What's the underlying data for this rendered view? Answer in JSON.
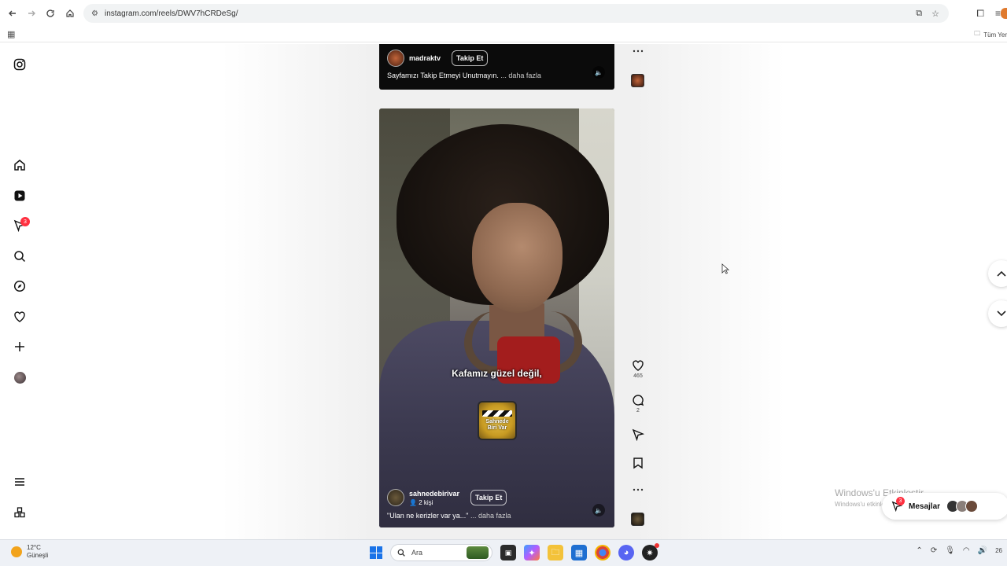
{
  "browser": {
    "url": "instagram.com/reels/DWV7hCRDeSg/",
    "bookmarks_right_label": "Tüm Yer"
  },
  "sidebar": {
    "notifications_badge": "3",
    "items": [
      {
        "icon": "instagram-logo-icon"
      },
      {
        "icon": "home-icon"
      },
      {
        "icon": "reels-icon"
      },
      {
        "icon": "messages-icon"
      },
      {
        "icon": "search-icon"
      },
      {
        "icon": "explore-icon"
      },
      {
        "icon": "heart-icon"
      },
      {
        "icon": "create-icon"
      },
      {
        "icon": "profile-avatar"
      },
      {
        "icon": "menu-icon"
      },
      {
        "icon": "more-apps-icon"
      }
    ]
  },
  "reel_prev": {
    "account": "madraktv",
    "follow_label": "Takip Et",
    "caption": "Sayfamızı Takip Etmeyi Unutmayın.",
    "more_label": "... daha fazla"
  },
  "reel_current": {
    "subtitle": "Kafamız güzel değil,",
    "stamp_line1": "Sahnede",
    "stamp_line2": "Biri Var",
    "account": "sahnedebirivar",
    "audience": "2 kişi",
    "follow_label": "Takip Et",
    "caption": "\"Ulan ne kerizler var ya...\"",
    "more_label": "... daha fazla",
    "likes": "465",
    "comments": "2"
  },
  "watermark": {
    "title": "Windows'u Etkinleştir",
    "subtitle": "Windows'u etkinleştirmek için Ayarlar'a gidin"
  },
  "messages": {
    "label": "Mesajlar",
    "badge": "3"
  },
  "taskbar": {
    "temperature": "12°C",
    "weather": "Güneşli",
    "search_placeholder": "Ara",
    "clock_partial": "26"
  }
}
